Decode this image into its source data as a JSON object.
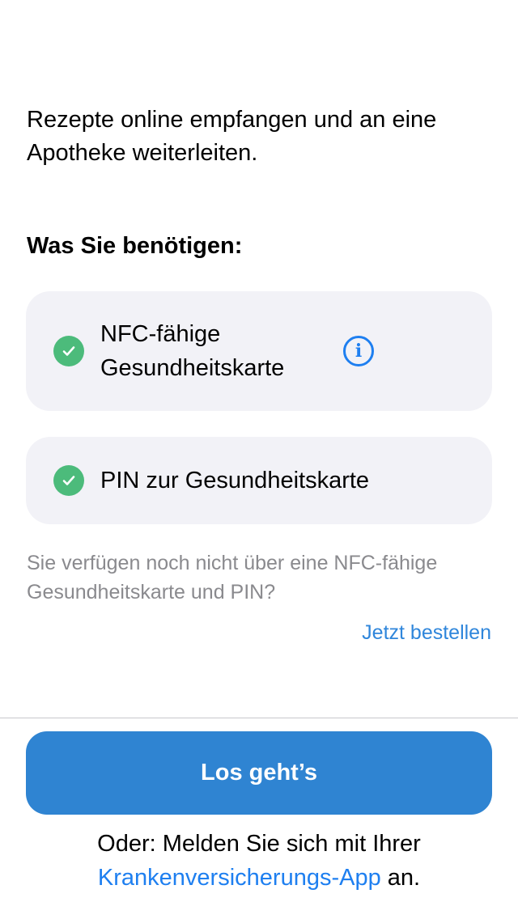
{
  "intro": "Rezepte online empfangen und an eine Apotheke weiterleiten.",
  "requirements_title": "Was Sie benötigen:",
  "requirements": [
    {
      "label": "NFC-fähige Gesundheitskarte",
      "icon": "check-circle-icon",
      "has_info": true
    },
    {
      "label": "PIN zur Gesundheitskarte",
      "icon": "check-circle-icon",
      "has_info": false
    }
  ],
  "hint": "Sie verfügen noch nicht über eine NFC-fähige Gesundheitskarte und PIN?",
  "order_link": "Jetzt bestellen",
  "primary_button": "Los geht’s",
  "footer": {
    "prefix": "Oder: Melden Sie sich mit Ihrer",
    "link": "Krankenversicherungs-App",
    "suffix": " an."
  },
  "colors": {
    "accent": "#1e7ff0",
    "button": "#2f84d2",
    "check": "#4cbb7b",
    "card": "#f2f2f7"
  }
}
